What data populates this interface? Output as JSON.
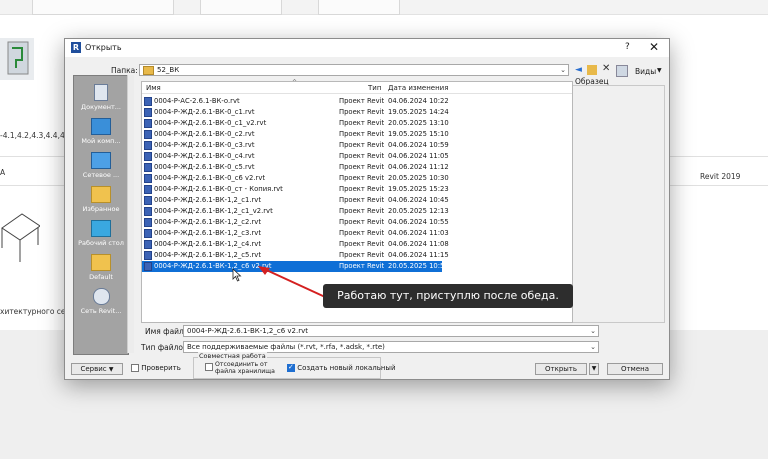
{
  "background": {
    "left_text": "-4.1,4.2,4.3,4.4,4...",
    "left_a": "A",
    "left_desc": "хитектурного се...",
    "right_revit": "Revit 2019"
  },
  "dialog": {
    "title": "Открыть",
    "help": "?",
    "close": "✕",
    "folder_label": "Папка:",
    "folder_value": "52_ВК",
    "views_label": "Виды",
    "preview_label": "Образец",
    "columns": {
      "name": "Имя",
      "type": "Тип",
      "date": "Дата изменения"
    },
    "files": [
      {
        "name": "0004-Р-АС-2.6.1-ВК-о.rvt",
        "type": "Проект Revit",
        "date": "04.06.2024 10:22"
      },
      {
        "name": "0004-Р-ЖД-2.6.1-ВК-0_c1.rvt",
        "type": "Проект Revit",
        "date": "19.05.2025 14:24"
      },
      {
        "name": "0004-Р-ЖД-2.6.1-ВК-0_c1_v2.rvt",
        "type": "Проект Revit",
        "date": "20.05.2025 13:10"
      },
      {
        "name": "0004-Р-ЖД-2.6.1-ВК-0_c2.rvt",
        "type": "Проект Revit",
        "date": "19.05.2025 15:10"
      },
      {
        "name": "0004-Р-ЖД-2.6.1-ВК-0_c3.rvt",
        "type": "Проект Revit",
        "date": "04.06.2024 10:59"
      },
      {
        "name": "0004-Р-ЖД-2.6.1-ВК-0_c4.rvt",
        "type": "Проект Revit",
        "date": "04.06.2024 11:05"
      },
      {
        "name": "0004-Р-ЖД-2.6.1-ВК-0_c5.rvt",
        "type": "Проект Revit",
        "date": "04.06.2024 11:12"
      },
      {
        "name": "0004-Р-ЖД-2.6.1-ВК-0_c6 v2.rvt",
        "type": "Проект Revit",
        "date": "20.05.2025 10:30"
      },
      {
        "name": "0004-Р-ЖД-2.6.1-ВК-0_ст - Копия.rvt",
        "type": "Проект Revit",
        "date": "19.05.2025 15:23"
      },
      {
        "name": "0004-Р-ЖД-2.6.1-ВК-1,2_c1.rvt",
        "type": "Проект Revit",
        "date": "04.06.2024 10:45"
      },
      {
        "name": "0004-Р-ЖД-2.6.1-ВК-1,2_c1_v2.rvt",
        "type": "Проект Revit",
        "date": "20.05.2025 12:13"
      },
      {
        "name": "0004-Р-ЖД-2.6.1-ВК-1,2_c2.rvt",
        "type": "Проект Revit",
        "date": "04.06.2024 10:55"
      },
      {
        "name": "0004-Р-ЖД-2.6.1-ВК-1,2_c3.rvt",
        "type": "Проект Revit",
        "date": "04.06.2024 11:03"
      },
      {
        "name": "0004-Р-ЖД-2.6.1-ВК-1,2_c4.rvt",
        "type": "Проект Revit",
        "date": "04.06.2024 11:08"
      },
      {
        "name": "0004-Р-ЖД-2.6.1-ВК-1,2_c5.rvt",
        "type": "Проект Revit",
        "date": "04.06.2024 11:15"
      },
      {
        "name": "0004-Р-ЖД-2.6.1-ВК-1,2_c6 v2.rvt",
        "type": "Проект Revit",
        "date": "20.05.2025 10:53"
      }
    ],
    "sidebar": [
      {
        "label": "Документ...",
        "icon": "documents-icon"
      },
      {
        "label": "Мой комп...",
        "icon": "computer-icon"
      },
      {
        "label": "Сетевое ...",
        "icon": "network-icon"
      },
      {
        "label": "Избранное",
        "icon": "favorites-folder-icon"
      },
      {
        "label": "Рабочий стол",
        "icon": "desktop-icon"
      },
      {
        "label": "Default",
        "icon": "default-folder-icon"
      },
      {
        "label": "Сеть Revit...",
        "icon": "revit-network-icon"
      }
    ],
    "filename_label": "Имя файла:",
    "filename_value": "0004-Р-ЖД-2.6.1-ВК-1,2_c6 v2.rvt",
    "filetype_label": "Тип файлов:",
    "filetype_value": "Все поддерживаемые файлы (*.rvt, *.rfa, *.adsk, *.rte)",
    "service_label": "Сервис",
    "check_label": "Проверить",
    "worksharing_title": "Совместная работа",
    "detach_label": "Отсоединить от файла хранилища",
    "create_local_label": "Создать новый локальный",
    "open_label": "Открыть",
    "cancel_label": "Отмена"
  },
  "callout": "Работаю тут, приступлю после обеда.",
  "colors": {
    "selection": "#0f6fd6",
    "callout_bg": "#2d2d2d",
    "arrow": "#d42020"
  }
}
